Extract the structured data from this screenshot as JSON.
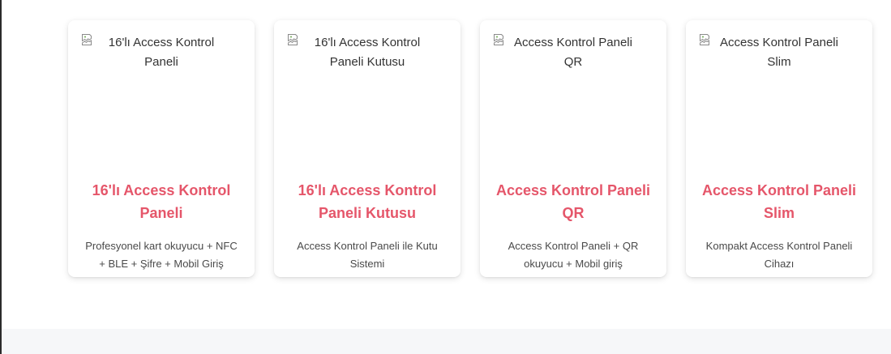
{
  "cards": [
    {
      "image_alt": "16'lı Access Kontrol Paneli",
      "title": "16'lı Access Kontrol Paneli",
      "description": "Profesyonel kart okuyucu + NFC + BLE + Şifre + Mobil Giriş"
    },
    {
      "image_alt": "16'lı Access Kontrol Paneli Kutusu",
      "title": "16'lı Access Kontrol Paneli Kutusu",
      "description": "Access Kontrol Paneli ile Kutu Sistemi"
    },
    {
      "image_alt": "Access Kontrol Paneli QR",
      "title": "Access Kontrol Paneli QR",
      "description": "Access Kontrol Paneli + QR okuyucu + Mobil giriş"
    },
    {
      "image_alt": "Access Kontrol Paneli Slim",
      "title": "Access Kontrol Paneli Slim",
      "description": "Kompakt Access Kontrol Paneli Cihazı"
    }
  ],
  "colors": {
    "title": "#e5566a",
    "description": "#4a4a4a",
    "footer_band": "#f6f7f9"
  },
  "icons": {
    "broken_image": "broken-image-icon"
  }
}
